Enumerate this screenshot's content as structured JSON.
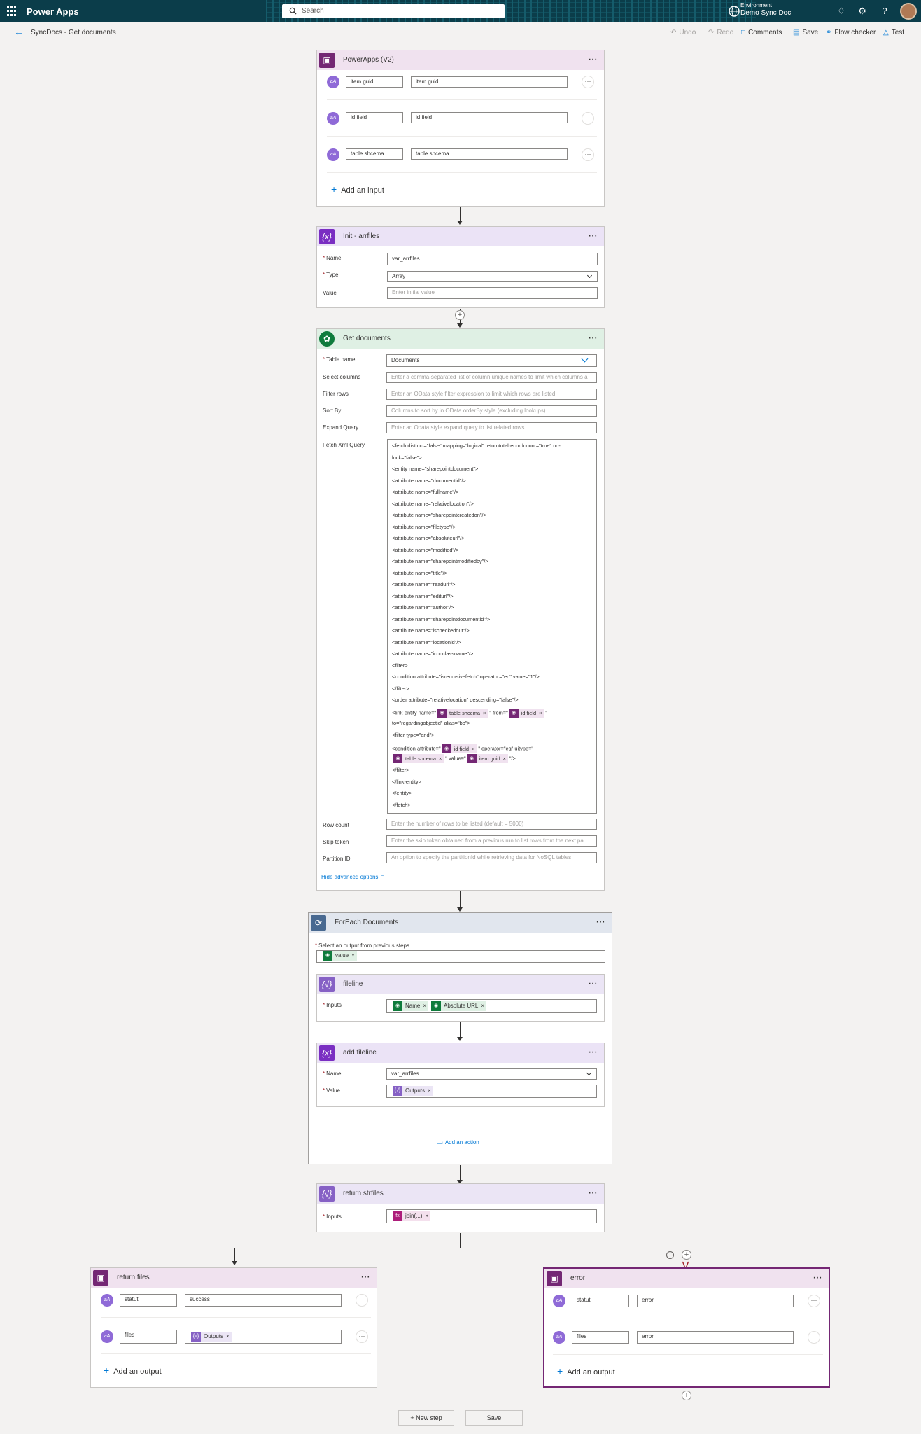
{
  "topbar": {
    "brand": "Power Apps",
    "search_placeholder": "Search",
    "env_label": "Environment",
    "env_name": "Demo Sync Doc"
  },
  "cmdbar": {
    "title": "SyncDocs - Get documents",
    "undo": "Undo",
    "redo": "Redo",
    "comments": "Comments",
    "save": "Save",
    "flow_checker": "Flow checker",
    "test": "Test"
  },
  "trigger": {
    "title": "PowerApps (V2)",
    "inputs": [
      {
        "name": "item guid",
        "desc": "item guid"
      },
      {
        "name": "id field",
        "desc": "id field"
      },
      {
        "name": "table shcema",
        "desc": "table shcema"
      }
    ],
    "add_input": "Add an input"
  },
  "init": {
    "title": "Init - arrfiles",
    "name_label": "Name",
    "name_value": "var_arrfiles",
    "type_label": "Type",
    "type_value": "Array",
    "value_label": "Value",
    "value_placeholder": "Enter initial value"
  },
  "getdocs": {
    "title": "Get documents",
    "table_label": "Table name",
    "table_value": "Documents",
    "select_label": "Select columns",
    "select_ph": "Enter a comma-separated list of column unique names to limit which columns a",
    "filter_label": "Filter rows",
    "filter_ph": "Enter an OData style filter expression to limit which rows are listed",
    "sort_label": "Sort By",
    "sort_ph": "Columns to sort by in OData orderBy style (excluding lookups)",
    "expand_label": "Expand Query",
    "expand_ph": "Enter an Odata style expand query to list related rows",
    "fetch_label": "Fetch Xml Query",
    "xml": {
      "l1": "<fetch distinct=\"false\" mapping=\"logical\" returntotalrecordcount=\"true\" no-",
      "l2": "lock=\"false\">",
      "lines": [
        "<entity name=\"sharepointdocument\">",
        "<attribute name=\"documentid\"/>",
        "<attribute name=\"fullname\"/>",
        "<attribute name=\"relativelocation\"/>",
        "<attribute name=\"sharepointcreatedon\"/>",
        "<attribute name=\"filetype\"/>",
        "<attribute name=\"absoluteurl\"/>",
        "<attribute name=\"modified\"/>",
        "<attribute name=\"sharepointmodifiedby\"/>",
        "<attribute name=\"title\"/>",
        "<attribute name=\"readurl\"/>",
        "<attribute name=\"editurl\"/>",
        "<attribute name=\"author\"/>",
        "<attribute name=\"sharepointdocumentid\"/>",
        "<attribute name=\"ischeckedout\"/>",
        "<attribute name=\"locationid\"/>",
        "<attribute name=\"iconclassname\"/>",
        "<filter>",
        "<condition attribute=\"isrecursivefetch\" operator=\"eq\" value=\"1\"/>",
        "</filter>",
        "<order attribute=\"relativelocation\" descending=\"false\"/>"
      ],
      "link_pre": "<link-entity name=\"",
      "link_mid": "\" from=\"",
      "link_post": "\"",
      "to_line": "to=\"regardingobjectid\" alias=\"bb\">",
      "filter_and": "<filter type=\"and\">",
      "cond_pre": "<condition attribute=\"",
      "cond_mid": "\" operator=\"eq\" uitype=\"",
      "cond_val": "\" value=\"",
      "cond_end": "\"/>",
      "closing": [
        "</filter>",
        "</link-entity>",
        "</entity>",
        "</fetch>"
      ]
    },
    "row_label": "Row count",
    "row_ph": "Enter the number of rows to be listed (default = 5000)",
    "skip_label": "Skip token",
    "skip_ph": "Enter the skip token obtained from a previous run to list rows from the next pa",
    "part_label": "Partition ID",
    "part_ph": "An option to specify the partitionId while retrieving data for NoSQL tables",
    "hide_adv": "Hide advanced options"
  },
  "tokens": {
    "table_shcema": "table shcema",
    "id_field": "id field",
    "item_guid": "item guid",
    "value": "value",
    "name": "Name",
    "absolute_url": "Absolute URL",
    "outputs": "Outputs",
    "join": "join(...)"
  },
  "foreach": {
    "title": "ForEach Documents",
    "select_label": "Select an output from previous steps",
    "fileline": {
      "title": "fileline",
      "inputs_label": "Inputs"
    },
    "addfileline": {
      "title": "add fileline",
      "name_label": "Name",
      "name_value": "var_arrfiles",
      "value_label": "Value"
    },
    "add_action": "Add an action"
  },
  "return_str": {
    "title": "return strfiles",
    "inputs_label": "Inputs"
  },
  "return_files": {
    "title": "return files",
    "rows": [
      {
        "name": "statut",
        "value": "success"
      },
      {
        "name": "files"
      }
    ],
    "add_output": "Add an output"
  },
  "error": {
    "title": "error",
    "rows": [
      {
        "name": "statut",
        "value": "error"
      },
      {
        "name": "files",
        "value": "error"
      }
    ],
    "add_output": "Add an output"
  },
  "footer": {
    "new_step": "+ New step",
    "save": "Save"
  },
  "colors": {
    "topbar": "#0b3d4a",
    "powerapps": "#742774",
    "variable": "#7a2ec2",
    "dataverse": "#0f7b3c",
    "loop": "#486991",
    "accent": "#0078d4"
  }
}
